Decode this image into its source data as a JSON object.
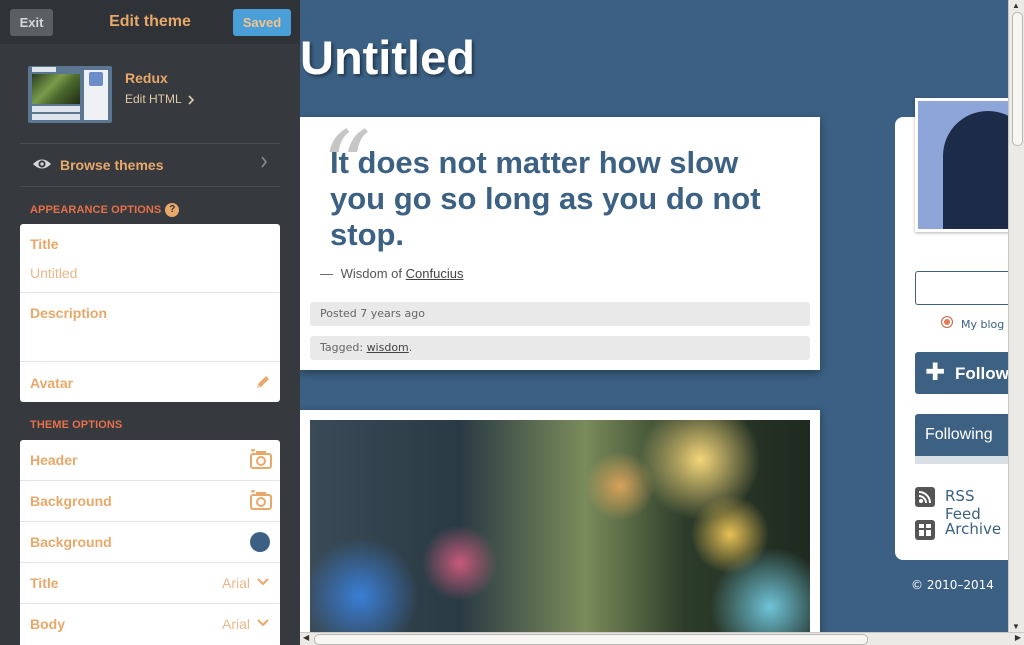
{
  "sidebar": {
    "exit_label": "Exit",
    "title": "Edit theme",
    "saved_label": "Saved",
    "theme": {
      "name": "Redux",
      "edit_html_label": "Edit HTML",
      "thumbnail_title": "Untitled"
    },
    "browse_label": "Browse themes",
    "appearance_heading": "APPEARANCE OPTIONS",
    "help_glyph": "?",
    "appearance": {
      "title_label": "Title",
      "title_value": "Untitled",
      "description_label": "Description",
      "avatar_label": "Avatar"
    },
    "theme_options_heading": "THEME OPTIONS",
    "theme_options": [
      {
        "label": "Header",
        "control": "camera-icon"
      },
      {
        "label": "Background",
        "control": "camera-icon"
      },
      {
        "label": "Background",
        "control": "color-swatch",
        "color": "#3b6083"
      },
      {
        "label": "Title",
        "control": "font-select",
        "value": "Arial"
      },
      {
        "label": "Body",
        "control": "font-select",
        "value": "Arial"
      }
    ]
  },
  "blog": {
    "title": "Untitled",
    "quote_post": {
      "quote_mark": "“",
      "text": "It does not matter how slow you go so long as you do not stop.",
      "source_prefix": "Wisdom of",
      "source_dash": "—",
      "source_link": "Confucius",
      "posted_label": "Posted 7 years ago",
      "tagged_label": "Tagged:",
      "tag": "wisdom",
      "tag_suffix": "."
    },
    "sidebar": {
      "my_blog_label": "My blog",
      "follow_label": "Follow",
      "following_label": "Following",
      "rss_label": "RSS Feed",
      "archive_label": "Archive",
      "copyright": "© 2010–2014"
    }
  },
  "colors": {
    "accent": "#e8a86a",
    "blog_background": "#3b6083",
    "saved_button": "#4b9fd8"
  }
}
